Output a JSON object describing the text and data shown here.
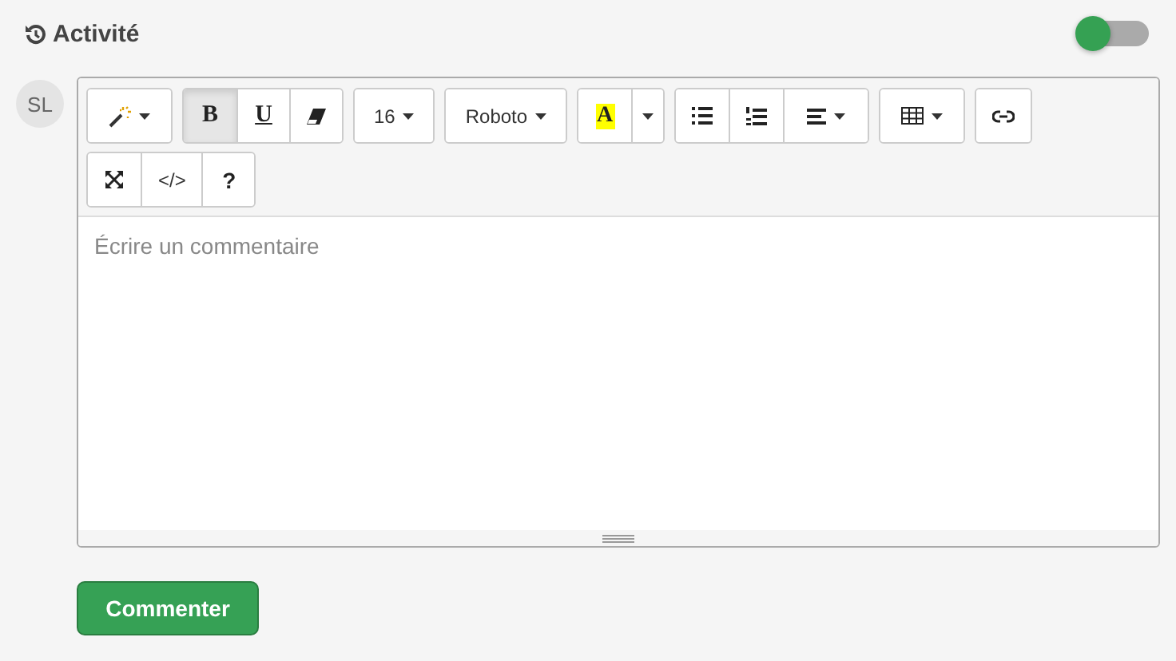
{
  "header": {
    "title": "Activité",
    "toggle": {
      "on": false
    }
  },
  "avatar": {
    "initials": "SL"
  },
  "editor": {
    "toolbar_rows": [
      [
        {
          "buttons": [
            {
              "kind": "magic",
              "caret": true,
              "selected": false
            }
          ]
        },
        {
          "buttons": [
            {
              "kind": "text",
              "label": "B",
              "selected": true
            },
            {
              "kind": "text",
              "label": "U",
              "underline": true,
              "selected": false
            },
            {
              "kind": "eraser",
              "selected": false
            }
          ]
        },
        {
          "buttons": [
            {
              "kind": "text",
              "label": "16",
              "caret": true,
              "selected": false
            }
          ]
        },
        {
          "buttons": [
            {
              "kind": "text",
              "label": "Roboto",
              "caret": true,
              "selected": false
            }
          ]
        },
        {
          "buttons": [
            {
              "kind": "highlight",
              "label": "A",
              "selected": false
            },
            {
              "kind": "caret",
              "selected": false
            }
          ]
        },
        {
          "buttons": [
            {
              "kind": "bullets",
              "selected": false
            },
            {
              "kind": "numbers",
              "selected": false
            },
            {
              "kind": "align",
              "caret": true,
              "selected": false
            }
          ]
        },
        {
          "buttons": [
            {
              "kind": "table",
              "caret": true,
              "selected": false
            }
          ]
        },
        {
          "buttons": [
            {
              "kind": "link",
              "selected": false
            }
          ]
        }
      ],
      [
        {
          "buttons": [
            {
              "kind": "fullscreen",
              "selected": false
            },
            {
              "kind": "text",
              "label": "</>",
              "selected": false
            },
            {
              "kind": "text",
              "label": "?",
              "selected": false
            }
          ]
        }
      ]
    ],
    "placeholder": "Écrire un commentaire"
  },
  "submit": {
    "label": "Commenter"
  }
}
